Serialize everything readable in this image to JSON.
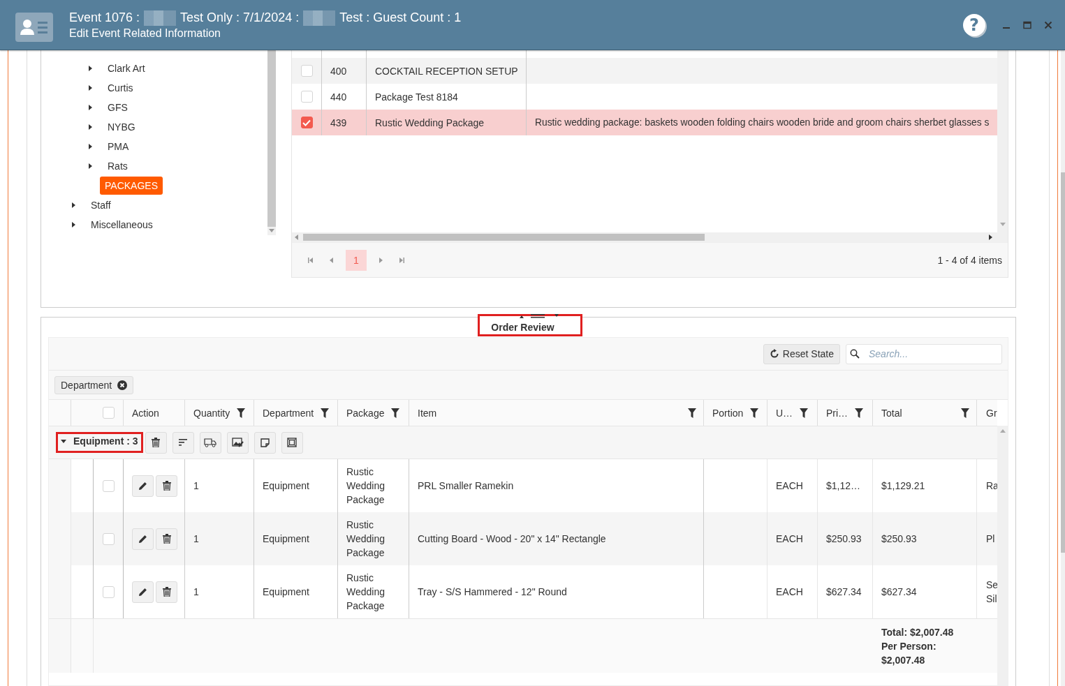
{
  "window": {
    "title_parts": [
      "Event 1076 :",
      "Test Only : 7/1/2024 :",
      "Test : Guest Count : 1"
    ],
    "subtitle": "Edit Event Related Information",
    "help": "?"
  },
  "tree": [
    {
      "children": [
        {
          "label": "Clark Art",
          "expandable": true,
          "selected": false
        },
        {
          "label": "Curtis",
          "expandable": true,
          "selected": false
        },
        {
          "label": "GFS",
          "expandable": true,
          "selected": false
        },
        {
          "label": "NYBG",
          "expandable": true,
          "selected": false
        },
        {
          "label": "PMA",
          "expandable": true,
          "selected": false
        },
        {
          "label": "Rats",
          "expandable": true,
          "selected": false
        },
        {
          "label": "PACKAGES",
          "expandable": false,
          "selected": true
        }
      ]
    },
    {
      "label": "Staff",
      "expandable": true,
      "selected": false
    },
    {
      "label": "Miscellaneous",
      "expandable": true,
      "selected": false
    }
  ],
  "packages": {
    "rows": [
      {
        "id": "400",
        "name": "COCKTAIL RECEPTION SETUP",
        "selected": false
      },
      {
        "id": "440",
        "name": "Package Test 8184",
        "selected": false
      },
      {
        "id": "439",
        "name": "Rustic Wedding Package",
        "description": "Rustic wedding package: baskets wooden folding chairs wooden bride and groom chairs sherbet glasses s",
        "selected": true
      }
    ],
    "pages": [
      {
        "label": "1",
        "selected": true
      }
    ],
    "summary": "1 - 4 of 4 items"
  },
  "order_review": {
    "title": "Order Review",
    "reset_button": "Reset State",
    "search": {
      "placeholder": "Search..."
    },
    "group_chips": [
      "Department"
    ],
    "select_all": {
      "checked": false
    },
    "columns": [
      {
        "label": "Action",
        "filter": false
      },
      {
        "label": "Quantity",
        "filter": true
      },
      {
        "label": "Department",
        "filter": true
      },
      {
        "label": "Package",
        "filter": true
      },
      {
        "label": "Item",
        "filter": true
      },
      {
        "label": "Portion",
        "filter": true
      },
      {
        "label": "U…",
        "filter": true
      },
      {
        "label": "Pri…",
        "filter": true
      },
      {
        "label": "Total",
        "filter": true
      },
      {
        "label": "Gr",
        "filter": false
      }
    ],
    "group": {
      "label": "Equipment : 3",
      "expanded": true
    },
    "rows": [
      {
        "selected": false,
        "quantity": "1",
        "department": "Equipment",
        "package": "Rustic Wedding Package",
        "item": "PRL Smaller Ramekin",
        "unit": "EACH",
        "price": "$1,12…",
        "total": "$1,129.21",
        "column_13": "Ra"
      },
      {
        "selected": false,
        "quantity": "1",
        "department": "Equipment",
        "package": "Rustic Wedding Package",
        "item": "Cutting Board - Wood - 20\" x 14\" Rectangle",
        "unit": "EACH",
        "price": "$250.93",
        "total": "$250.93",
        "column_13": "Pl"
      },
      {
        "selected": false,
        "quantity": "1",
        "department": "Equipment",
        "package": "Rustic Wedding Package",
        "item": "Tray - S/S Hammered - 12\" Round",
        "unit": "EACH",
        "price": "$627.34",
        "total": "$627.34",
        "column_13": "Se Sil"
      }
    ],
    "footer": [
      "Total: $2,007.48",
      "Per Person:",
      "$2,007.48"
    ]
  }
}
